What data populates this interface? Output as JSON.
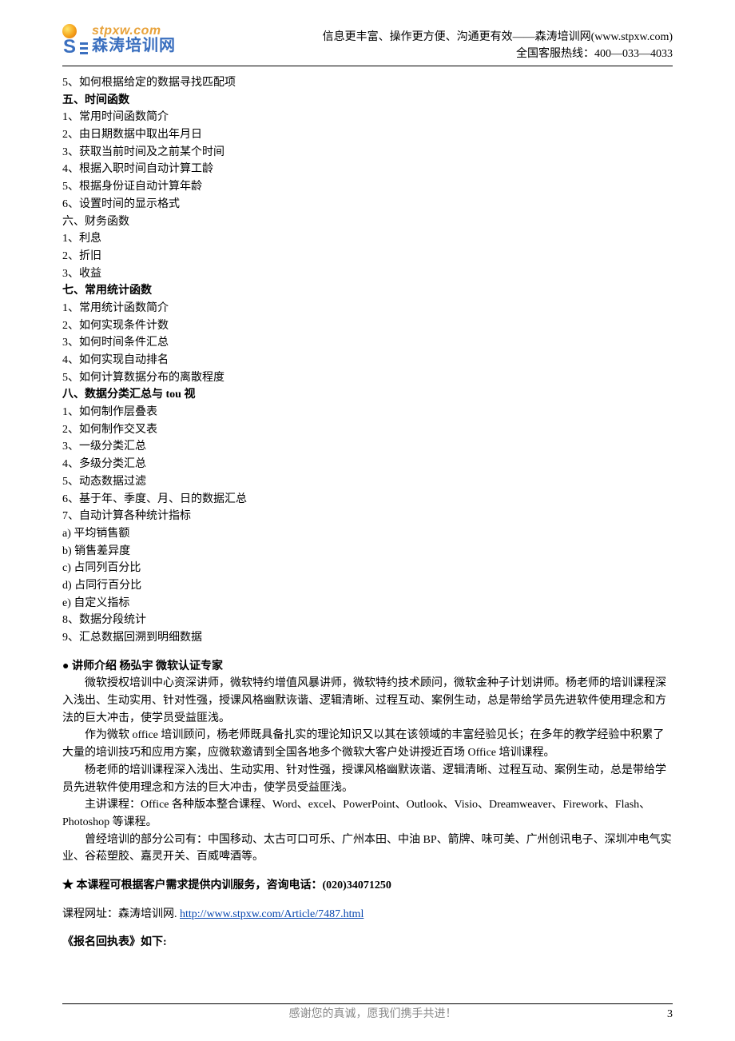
{
  "header": {
    "logo_domain": "stpxw.com",
    "logo_cn": "森涛培训网",
    "tagline": "信息更丰富、操作更方便、沟通更有效——森涛培训网(www.stpxw.com)",
    "hotline": "全国客服热线：400—033—4033"
  },
  "lines": [
    {
      "t": "5、如何根据给定的数据寻找匹配项"
    },
    {
      "t": "五、时间函数",
      "b": true
    },
    {
      "t": "1、常用时间函数简介"
    },
    {
      "t": "2、由日期数据中取出年月日"
    },
    {
      "t": "3、获取当前时间及之前某个时间"
    },
    {
      "t": "4、根据入职时间自动计算工龄"
    },
    {
      "t": "5、根据身份证自动计算年龄"
    },
    {
      "t": "6、设置时间的显示格式"
    },
    {
      "t": "六、财务函数"
    },
    {
      "t": "1、利息"
    },
    {
      "t": "2、折旧"
    },
    {
      "t": "3、收益"
    },
    {
      "t": "七、常用统计函数",
      "b": true
    },
    {
      "t": "1、常用统计函数简介"
    },
    {
      "t": "2、如何实现条件计数"
    },
    {
      "t": "3、如何时间条件汇总"
    },
    {
      "t": "4、如何实现自动排名"
    },
    {
      "t": "5、如何计算数据分布的离散程度"
    },
    {
      "t": "八、数据分类汇总与 tou 视",
      "b": true
    },
    {
      "t": "1、如何制作层叠表"
    },
    {
      "t": "2、如何制作交叉表"
    },
    {
      "t": "3、一级分类汇总"
    },
    {
      "t": "4、多级分类汇总"
    },
    {
      "t": "5、动态数据过滤"
    },
    {
      "t": "6、基于年、季度、月、日的数据汇总"
    },
    {
      "t": "7、自动计算各种统计指标"
    },
    {
      "t": "a) 平均销售额"
    },
    {
      "t": "b) 销售差异度"
    },
    {
      "t": "c) 占同列百分比"
    },
    {
      "t": "d) 占同行百分比"
    },
    {
      "t": "e) 自定义指标"
    },
    {
      "t": "8、数据分段统计"
    },
    {
      "t": "9、汇总数据回溯到明细数据"
    }
  ],
  "instructor_heading": "● 讲师介绍 杨弘宇   微软认证专家",
  "instructor_paras": [
    "微软授权培训中心资深讲师，微软特约增值风暴讲师，微软特约技术顾问，微软金种子计划讲师。杨老师的培训课程深入浅出、生动实用、针对性强，授课风格幽默诙谐、逻辑清晰、过程互动、案例生动，总是带给学员先进软件使用理念和方法的巨大冲击，使学员受益匪浅。",
    "作为微软 office 培训顾问，杨老师既具备扎实的理论知识又以其在该领域的丰富经验见长；在多年的教学经验中积累了大量的培训技巧和应用方案，应微软邀请到全国各地多个微软大客户处讲授近百场 Office 培训课程。",
    "杨老师的培训课程深入浅出、生动实用、针对性强，授课风格幽默诙谐、逻辑清晰、过程互动、案例生动，总是带给学员先进软件使用理念和方法的巨大冲击，使学员受益匪浅。",
    "主讲课程：Office 各种版本整合课程、Word、excel、PowerPoint、Outlook、Visio、Dreamweaver、Firework、Flash、Photoshop 等课程。",
    "曾经培训的部分公司有：中国移动、太古可口可乐、广州本田、中油 BP、箭牌、味可美、广州创讯电子、深圳冲电气实业、谷菘塑胶、嘉灵开关、百威啤酒等。"
  ],
  "internal_training": "★ 本课程可根据客户需求提供内训服务，咨询电话：(020)34071250",
  "course_url_label": "课程网址：森涛培训网. ",
  "course_url": "http://www.stpxw.com/Article/7487.html",
  "receipt_heading": "《报名回执表》如下:",
  "footer": {
    "slogan": "感谢您的真诚，愿我们携手共进！",
    "page": "3"
  }
}
